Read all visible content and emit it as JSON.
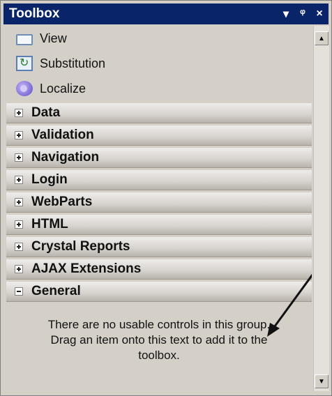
{
  "window": {
    "title": "Toolbox"
  },
  "titlebar_buttons": {
    "dropdown": "▾",
    "pin": "ᵠ",
    "close": "×"
  },
  "items": [
    {
      "label": "View",
      "icon": "view-icon"
    },
    {
      "label": "Substitution",
      "icon": "substitution-icon"
    },
    {
      "label": "Localize",
      "icon": "localize-icon"
    }
  ],
  "groups": [
    {
      "label": "Data",
      "state": "collapsed"
    },
    {
      "label": "Validation",
      "state": "collapsed"
    },
    {
      "label": "Navigation",
      "state": "collapsed"
    },
    {
      "label": "Login",
      "state": "collapsed"
    },
    {
      "label": "WebParts",
      "state": "collapsed"
    },
    {
      "label": "HTML",
      "state": "collapsed"
    },
    {
      "label": "Crystal Reports",
      "state": "collapsed"
    },
    {
      "label": "AJAX Extensions",
      "state": "collapsed"
    },
    {
      "label": "General",
      "state": "expanded"
    }
  ],
  "general": {
    "message_line1": "There are no usable controls in this group.",
    "message_line2": "Drag an item onto this text to add it to the",
    "message_line3": "toolbox."
  },
  "colors": {
    "titlebar": "#0a246a",
    "panel": "#d4d0c8"
  }
}
